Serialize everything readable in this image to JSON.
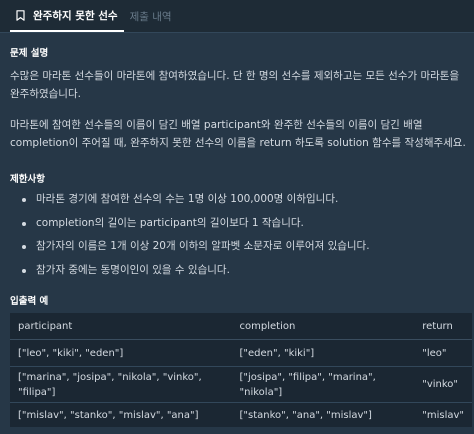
{
  "tabs": [
    {
      "label": "완주하지 못한 선수",
      "active": true,
      "icon": "bookmark-icon"
    },
    {
      "label": "제출 내역",
      "active": false
    }
  ],
  "sections": {
    "description": {
      "title": "문제 설명",
      "paragraphs": [
        "수많은 마라톤 선수들이 마라톤에 참여하였습니다. 단 한 명의 선수를 제외하고는 모든 선수가 마라톤을 완주하였습니다.",
        "마라톤에 참여한 선수들의 이름이 담긴 배열 participant와 완주한 선수들의 이름이 담긴 배열 completion이 주어질 때, 완주하지 못한 선수의 이름을 return 하도록 solution 함수를 작성해주세요."
      ]
    },
    "constraints": {
      "title": "제한사항",
      "items": [
        "마라톤 경기에 참여한 선수의 수는 1명 이상 100,000명 이하입니다.",
        "completion의 길이는 participant의 길이보다 1 작습니다.",
        "참가자의 이름은 1개 이상 20개 이하의 알파벳 소문자로 이루어져 있습니다.",
        "참가자 중에는 동명이인이 있을 수 있습니다."
      ]
    },
    "examples": {
      "title": "입출력 예",
      "headers": [
        "participant",
        "completion",
        "return"
      ],
      "rows": [
        [
          "[\"leo\", \"kiki\", \"eden\"]",
          "[\"eden\", \"kiki\"]",
          "\"leo\""
        ],
        [
          "[\"marina\", \"josipa\", \"nikola\", \"vinko\", \"filipa\"]",
          "[\"josipa\", \"filipa\", \"marina\", \"nikola\"]",
          "\"vinko\""
        ],
        [
          "[\"mislav\", \"stanko\", \"mislav\", \"ana\"]",
          "[\"stanko\", \"ana\", \"mislav\"]",
          "\"mislav\""
        ]
      ]
    }
  },
  "colors": {
    "background": "#263747",
    "tab_bar": "#1e2b36",
    "table_background": "#1b2733",
    "text": "#d5dbe2",
    "heading": "#ffffff",
    "inactive_tab": "#6a7c8c"
  }
}
